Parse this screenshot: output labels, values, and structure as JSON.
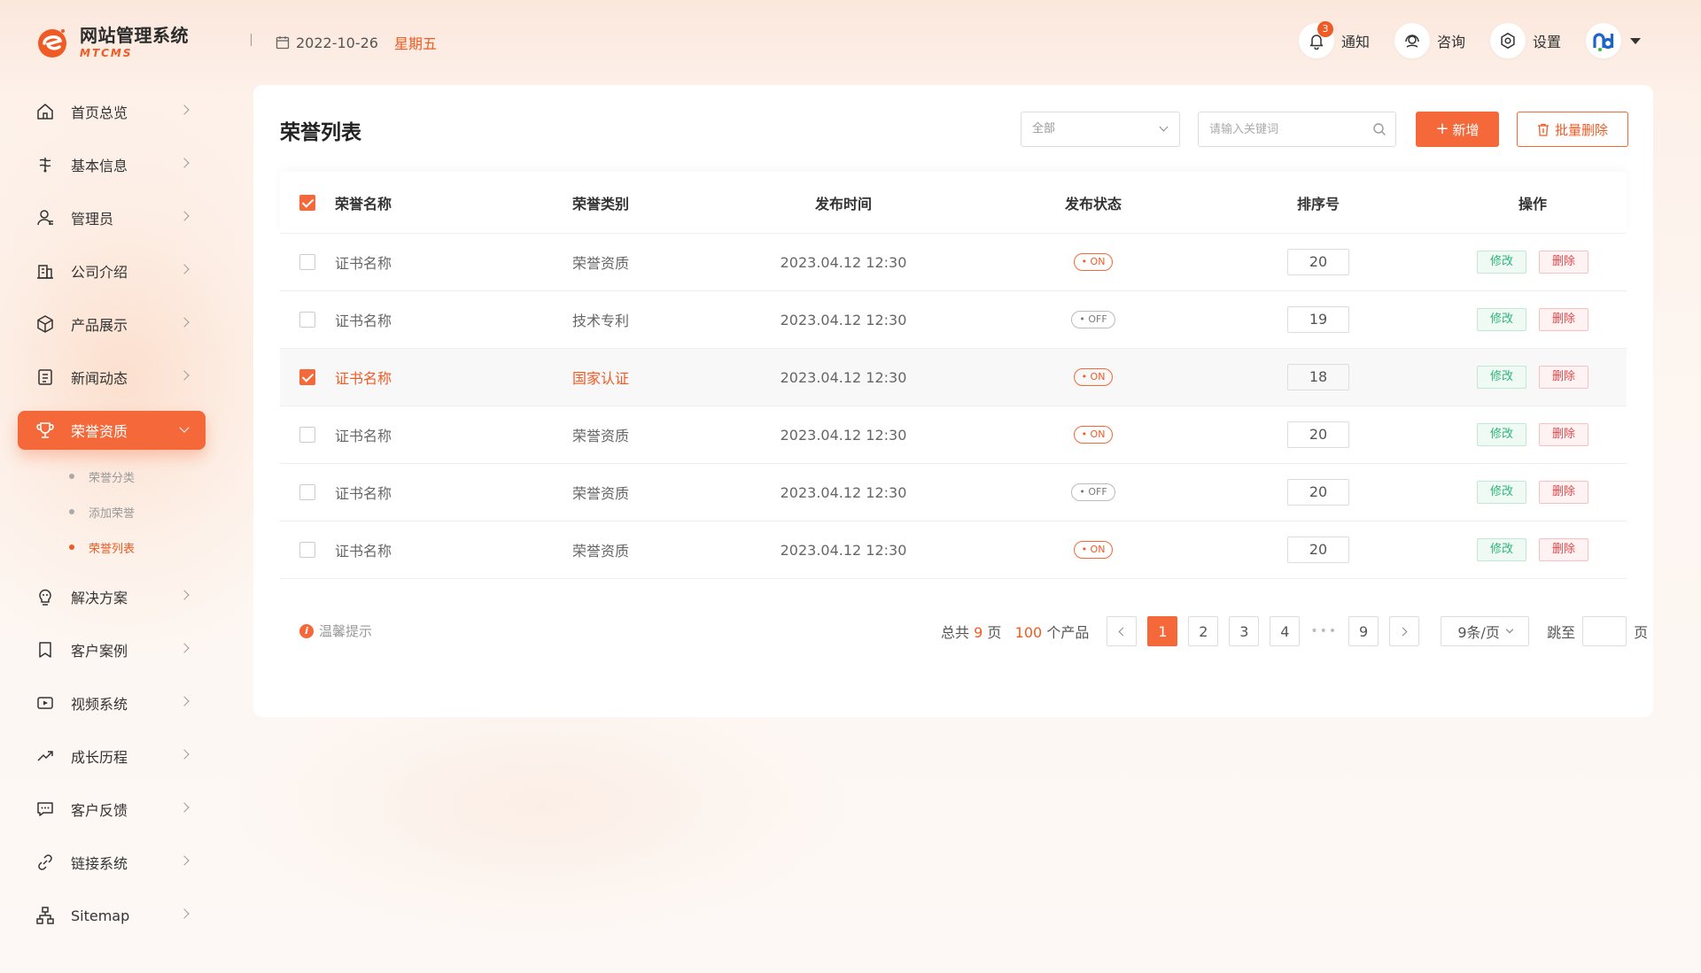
{
  "app": {
    "title": "网站管理系统",
    "subtitle": "MTCMS"
  },
  "header": {
    "date": "2022-10-26",
    "weekday": "星期五",
    "notify_label": "通知",
    "notify_count": "3",
    "consult_label": "咨询",
    "settings_label": "设置"
  },
  "sidebar": {
    "items": [
      {
        "label": "首页总览",
        "icon": "home-icon"
      },
      {
        "label": "基本信息",
        "icon": "info-icon"
      },
      {
        "label": "管理员",
        "icon": "user-icon"
      },
      {
        "label": "公司介绍",
        "icon": "building-icon"
      },
      {
        "label": "产品展示",
        "icon": "box-icon"
      },
      {
        "label": "新闻动态",
        "icon": "news-icon"
      },
      {
        "label": "荣誉资质",
        "icon": "trophy-icon",
        "active": true
      },
      {
        "label": "解决方案",
        "icon": "bulb-icon"
      },
      {
        "label": "客户案例",
        "icon": "bookmark-icon"
      },
      {
        "label": "视频系统",
        "icon": "video-icon"
      },
      {
        "label": "成长历程",
        "icon": "trend-icon"
      },
      {
        "label": "客户反馈",
        "icon": "chat-icon"
      },
      {
        "label": "链接系统",
        "icon": "link-icon"
      },
      {
        "label": "Sitemap",
        "icon": "sitemap-icon"
      }
    ],
    "sub_items": [
      {
        "label": "荣誉分类",
        "active": false
      },
      {
        "label": "添加荣誉",
        "active": false
      },
      {
        "label": "荣誉列表",
        "active": true
      }
    ]
  },
  "main": {
    "title": "荣誉列表",
    "filter_value": "全部",
    "search_placeholder": "请输入关键词",
    "add_label": "新增",
    "batch_delete_label": "批量删除",
    "columns": [
      "荣誉名称",
      "荣誉类别",
      "发布时间",
      "发布状态",
      "排序号",
      "操作"
    ],
    "rows": [
      {
        "name": "证书名称",
        "category": "荣誉资质",
        "time": "2023.04.12 12:30",
        "status": "• ON",
        "status_on": true,
        "sort": "20",
        "checked": false
      },
      {
        "name": "证书名称",
        "category": "技术专利",
        "time": "2023.04.12 12:30",
        "status": "• OFF",
        "status_on": false,
        "sort": "19",
        "checked": false
      },
      {
        "name": "证书名称",
        "category": "国家认证",
        "time": "2023.04.12 12:30",
        "status": "• ON",
        "status_on": true,
        "sort": "18",
        "checked": true
      },
      {
        "name": "证书名称",
        "category": "荣誉资质",
        "time": "2023.04.12 12:30",
        "status": "• ON",
        "status_on": true,
        "sort": "20",
        "checked": false
      },
      {
        "name": "证书名称",
        "category": "荣誉资质",
        "time": "2023.04.12 12:30",
        "status": "• OFF",
        "status_on": false,
        "sort": "20",
        "checked": false
      },
      {
        "name": "证书名称",
        "category": "荣誉资质",
        "time": "2023.04.12 12:30",
        "status": "• ON",
        "status_on": true,
        "sort": "20",
        "checked": false
      }
    ],
    "edit_label": "修改",
    "delete_label": "删除"
  },
  "footer": {
    "tip": "温馨提示",
    "total_prefix": "总共",
    "total_pages": "9",
    "total_pages_unit": "页",
    "total_items": "100",
    "total_items_unit": "个产品",
    "pages": [
      "1",
      "2",
      "3",
      "4",
      "9"
    ],
    "current_page": "1",
    "ellipsis": "•••",
    "page_size": "9条/页",
    "jump_label": "跳至",
    "jump_unit": "页"
  },
  "colors": {
    "accent": "#f4683a",
    "accent_text": "#f05a24",
    "edit_green": "#2fb57a",
    "delete_red": "#e5484d"
  }
}
